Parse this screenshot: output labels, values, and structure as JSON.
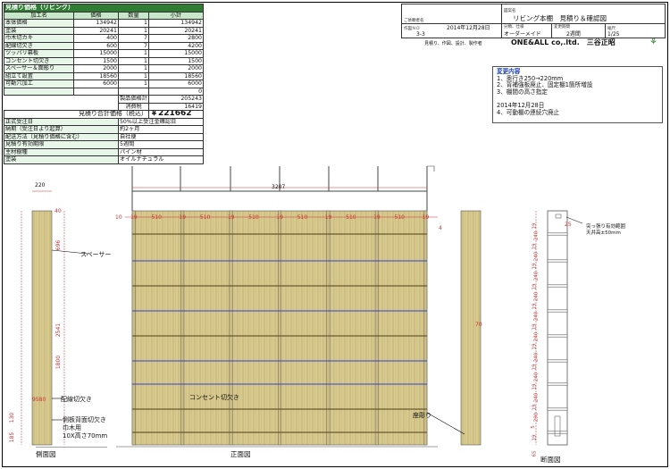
{
  "estimate": {
    "title": "見積り価格（リビング）",
    "headers": [
      "加工名",
      "価格",
      "数量",
      "小計"
    ],
    "rows": [
      [
        "本体価格",
        "134942",
        "1",
        "134942"
      ],
      [
        "塗装",
        "20241",
        "1",
        "20241"
      ],
      [
        "巾木切カキ",
        "400",
        "7",
        "2800"
      ],
      [
        "配線切欠き",
        "600",
        "7",
        "4200"
      ],
      [
        "ツッパリ幕板",
        "15000",
        "1",
        "15000"
      ],
      [
        "コンセント切欠き",
        "1500",
        "1",
        "1500"
      ],
      [
        "スペーサー＆面彫り",
        "2000",
        "1",
        "2000"
      ],
      [
        "組立て設置",
        "18560",
        "1",
        "18560"
      ],
      [
        "可動穴加工",
        "6000",
        "1",
        "6000"
      ],
      [
        "",
        "",
        "",
        "0"
      ]
    ],
    "subtotal_label": "製品価格計",
    "subtotal_value": "205243",
    "tax_label": "消費税",
    "tax_value": "16419",
    "total_label": "見積り合計価格（税込）",
    "total_value": "￥221662",
    "conditions": [
      [
        "正式受注日",
        "50%以上受注金確認日"
      ],
      [
        "納期（受注日より起算）",
        "約2ヶ月"
      ],
      [
        "配送方法（見積り価格に含む）",
        "自社便"
      ],
      [
        "見積り有効期限",
        "5週間"
      ],
      [
        "主材樹種",
        "パイン材"
      ],
      [
        "塗装",
        "オイルナチュラル"
      ]
    ]
  },
  "title_block": {
    "customer_caption": "ご依頼者名",
    "drawing_name_caption": "図案名",
    "drawing_name": "リビング本棚　見積り＆確認図",
    "drawing_no_caption": "作図ＮＯ",
    "drawing_no": "3-3",
    "date_caption": "作図日",
    "date": "2014年12月28日",
    "category_caption": "分類、仕様",
    "category": "オーダーメイド",
    "delivery_caption": "変更期間",
    "delivery": "2週間",
    "scale_caption": "縮尺",
    "scale": "1/25",
    "company_caption": "見積り、作図、設計、製作者",
    "company": "ONE&ALL co,.ltd.　三谷正昭"
  },
  "changes": {
    "title": "変更内容",
    "lines": [
      "1、奥行き250→220mm",
      "2、背補強板廃止、固定棚1箇所増設",
      "3、棚間の高さ指定",
      "",
      "2014年12月28日",
      "4、可動棚の連続穴廃止"
    ]
  },
  "drawing": {
    "side_width": "220",
    "side_top": "40",
    "side_dim_696": "696",
    "side_dim_2541": "2541",
    "side_dim_1800": "1800",
    "side_dim_9580": "9580",
    "side_dim_130": "130",
    "side_dim_185": "185",
    "side_dim_70": "70",
    "label_spacer": "スペーサー",
    "label_wiring": "配線切欠き",
    "label_back_cut": "側板背面切欠き",
    "label_skirting": "巾木用",
    "label_skirting_size": "10X高さ70mm",
    "label_outlet": "コンセント切欠き",
    "label_engrave": "座彫り",
    "label_side_view": "側面図",
    "label_front_view": "正面図",
    "label_section_view": "断面図",
    "overall_width": "3207",
    "left_margin": "10",
    "right_margin": "4",
    "gap": "19",
    "bay": "510",
    "section_note_1": "突っ張り有効範囲",
    "section_note_2": "天井高±50mm",
    "section_dim_25": "25",
    "section_dims": [
      "19",
      "240",
      "19",
      "240",
      "19",
      "240",
      "19",
      "240",
      "19",
      "240",
      "19",
      "240",
      "19",
      "240",
      "19",
      "240",
      "19",
      "240",
      "19",
      "290",
      "5",
      "19"
    ],
    "section_dims_first": "65"
  }
}
